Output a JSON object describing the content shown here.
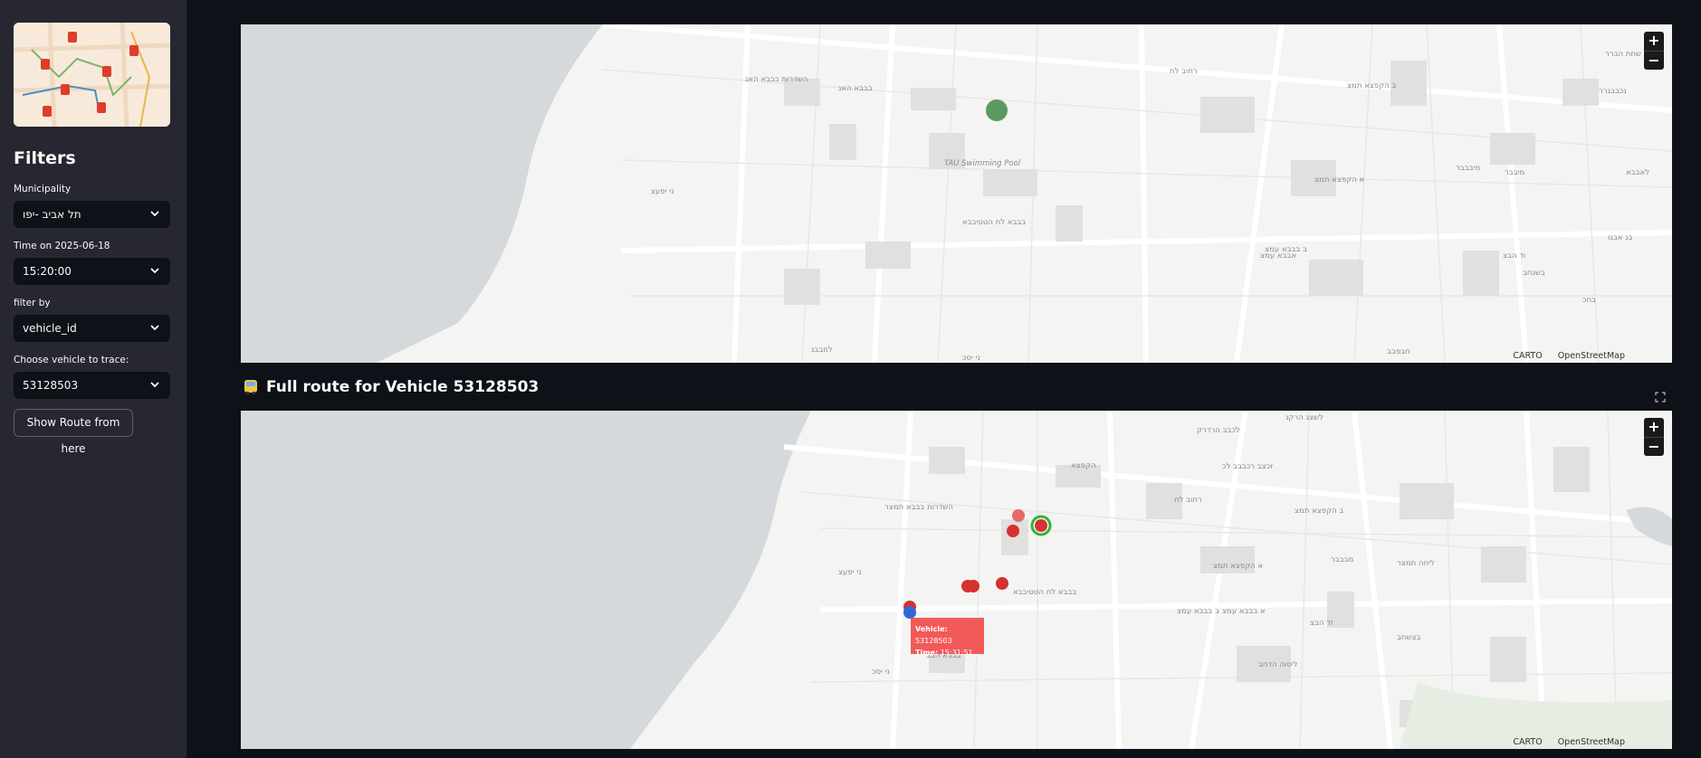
{
  "sidebar": {
    "logo_icon": "bus-route-map-icon",
    "filters_title": "Filters",
    "municipality": {
      "label": "Municipality",
      "value": "תל אביב -יפו"
    },
    "time": {
      "label": "Time on 2025-06-18",
      "value": "15:20:00"
    },
    "filter_by": {
      "label": "filter by",
      "value": "vehicle_id"
    },
    "vehicle": {
      "label": "Choose vehicle to trace:",
      "value": "53128503"
    },
    "show_route_button": "Show Route from here"
  },
  "route_section": {
    "icon": "bus-icon",
    "title": "Full route for Vehicle 53128503"
  },
  "maps": {
    "zoom_in": "+",
    "zoom_out": "−",
    "attribution": [
      "CARTO",
      "OpenStreetMap"
    ],
    "map1_labels": [
      "השדרות בבבא האנ",
      "בבבא האנ",
      "רחוב לח",
      "ב הקפצא תמצ",
      "TAU Swimming Pool",
      "בבבא לח הטטיבבא",
      "אבבא עמצ",
      "ב בבבא עמצ",
      "א הקפצא תמצ",
      "מיבבבר",
      "ני יפעצ",
      "לאבבא",
      "שחת הברר",
      "נכבבגרר",
      "בנ אבגו",
      "בחכ",
      "חבפבב",
      "בשנחב",
      "וד הבצ",
      "מיבבר",
      "לחבבנ",
      "ני יסכ"
    ],
    "map2_labels": [
      "לשצג הרקנ",
      "לכבב הרדרק",
      "הקפצא",
      "זכצב רכבבב לכ",
      "רחוב לח",
      "ב הקפצא תמצ",
      "השדרות בבבא תמצר",
      "ני יפעצ",
      "בבבא לח הטטיבבא",
      "א הקפצא תמצ",
      "מבבבר",
      "ליחה תמצר",
      "ב בבבא עמצ",
      "א בבבא עמצ",
      "זד הבצ",
      "ליסוה הדחב",
      "בצשחב",
      "ני יסכ",
      "בבבא הבב"
    ],
    "tooltip": {
      "vehicle_label": "Vehicle:",
      "vehicle_value": "53128503",
      "time_label": "Time:",
      "time_value": "15:31:51"
    },
    "colors": {
      "current_position": "#5a9a5f",
      "route_point": "#d63030",
      "route_point_light": "#e46a6a",
      "start_ring": "#2eb82e",
      "end_point": "#2f6bd4",
      "tooltip_bg": "#f25a5a",
      "sea": "#d5d9dc",
      "land": "#f4f4f2"
    }
  }
}
